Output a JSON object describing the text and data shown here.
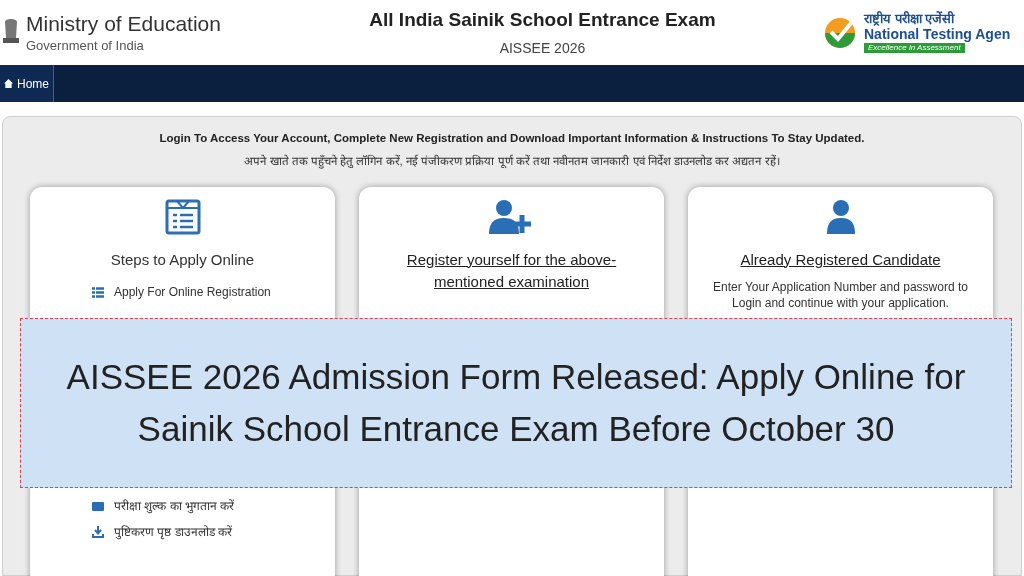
{
  "header": {
    "ministry": "Ministry of Education",
    "government": "Government of India",
    "title": "All India Sainik School Entrance Exam",
    "subtitle": "AISSEE 2026",
    "agency_hindi": "राष्ट्रीय परीक्षा एजेंसी",
    "agency": "National Testing Agen",
    "agency_tagline": "Excellence in Assessment"
  },
  "nav": {
    "items": [
      {
        "label": "Home",
        "selected": true
      }
    ]
  },
  "intro": {
    "english": "Login To Access Your Account, Complete New Registration and Download Important Information & Instructions To Stay Updated.",
    "hindi": "अपने खाते तक पहुँचने हेतु लॉगिन करें, नई पंजीकरण प्रक्रिया पूर्ण करें तथा नवीनतम जानकारी एवं निर्देश डाउनलोड कर अद्यतन रहें।"
  },
  "cards": [
    {
      "kind": "steps",
      "title": "Steps to Apply Online",
      "items": [
        {
          "kind": "list",
          "label": "Apply For Online Registration"
        },
        {
          "kind": "payment",
          "label": "परीक्षा शुल्क का भुगतान करें"
        },
        {
          "kind": "download",
          "label": "पुष्टिकरण पृष्ठ डाउनलोड करें"
        }
      ]
    },
    {
      "kind": "register",
      "title": "Register yourself for the above-mentioned examination"
    },
    {
      "kind": "login",
      "title": "Already Registered Candidate",
      "text": "Enter Your Application Number and password to Login and continue with your application."
    }
  ],
  "banner": {
    "text": "AISSEE 2026 Admission Form Released: Apply Online for Sainik School Entrance Exam Before October 30"
  }
}
